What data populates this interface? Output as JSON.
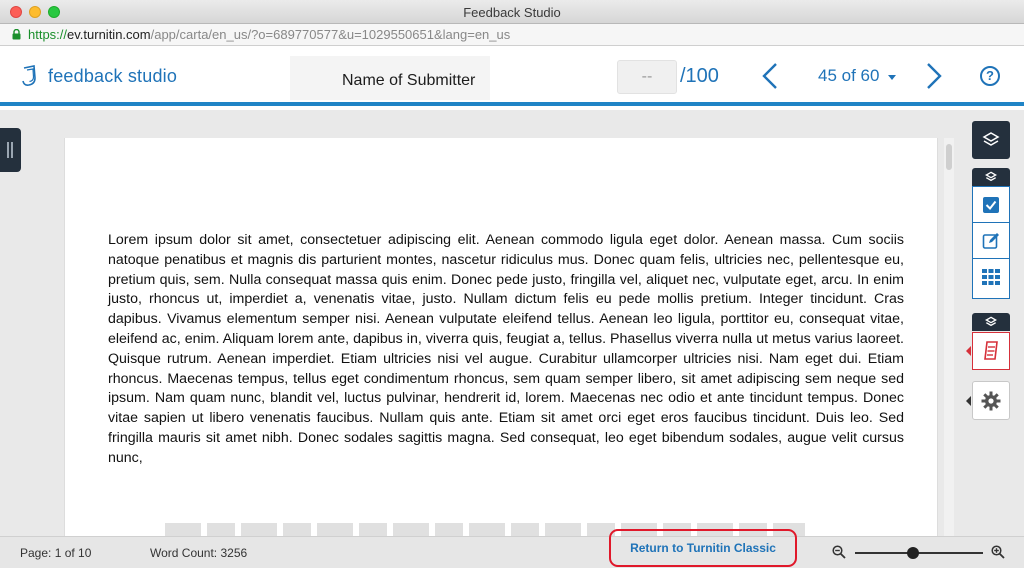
{
  "window": {
    "title": "Feedback Studio"
  },
  "browser": {
    "url_protocol": "https://",
    "url_host": "ev.turnitin.com",
    "url_path": "/app/carta/en_us/?o=689770577&u=1029550651&lang=en_us"
  },
  "header": {
    "logo_text": "feedback studio",
    "submitter_name": "Name of Submitter",
    "score_value": "--",
    "score_total": "/100",
    "page_position": "45 of 60",
    "help_label": "?"
  },
  "document": {
    "body": "Lorem ipsum dolor sit amet, consectetuer adipiscing elit. Aenean commodo ligula eget dolor. Aenean massa. Cum sociis natoque penatibus et magnis dis parturient montes, nascetur ridiculus mus. Donec quam felis, ultricies nec, pellentesque eu, pretium quis, sem. Nulla consequat massa quis enim. Donec pede justo, fringilla vel, aliquet nec, vulputate eget, arcu. In enim justo, rhoncus ut, imperdiet a, venenatis vitae, justo. Nullam dictum felis eu pede mollis pretium. Integer tincidunt. Cras dapibus. Vivamus elementum semper nisi. Aenean vulputate eleifend tellus. Aenean leo ligula, porttitor eu, consequat vitae, eleifend ac, enim. Aliquam lorem ante, dapibus in, viverra quis, feugiat a, tellus. Phasellus viverra nulla ut metus varius laoreet. Quisque rutrum. Aenean imperdiet. Etiam ultricies nisi vel augue. Curabitur ullamcorper ultricies nisi. Nam eget dui. Etiam rhoncus. Maecenas tempus, tellus eget condimentum rhoncus, sem quam semper libero, sit amet adipiscing sem neque sed ipsum. Nam quam nunc, blandit vel, luctus pulvinar, hendrerit id, lorem. Maecenas nec odio et ante tincidunt tempus. Donec vitae sapien ut libero venenatis faucibus. Nullam quis ante. Etiam sit amet orci eget eros faucibus tincidunt. Duis leo. Sed fringilla mauris sit amet nibh. Donec sodales sagittis magna. Sed consequat, leo eget bibendum sodales, augue velit cursus nunc,"
  },
  "status": {
    "page_label": "Page: 1 of 10",
    "word_count_label": "Word Count: 3256",
    "return_button_label": "Return to Turnitin Classic",
    "zoom_level": 0.45
  },
  "colors": {
    "brand_blue": "#1f73b8",
    "header_rule": "#1f84c6",
    "toolbar_dark": "#24303d",
    "similarity_red": "#d6303a",
    "highlight_red": "#e0182a"
  },
  "icons": {
    "lock": "lock-icon",
    "layers": "layers-icon",
    "check": "check-icon",
    "edit": "edit-icon",
    "grid": "grid-icon",
    "similarity": "similarity-report-icon",
    "settings": "gear-icon",
    "zoom_out": "zoom-out-icon",
    "zoom_in": "zoom-in-icon"
  }
}
